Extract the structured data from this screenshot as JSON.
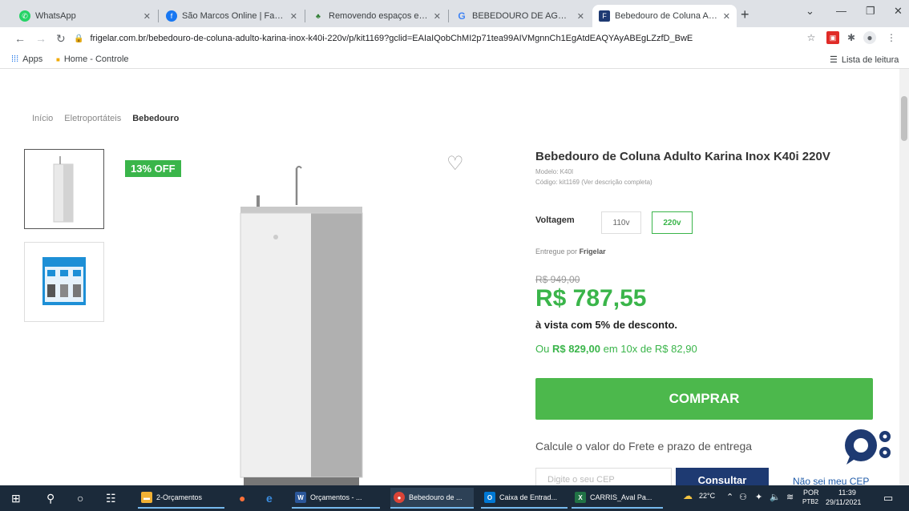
{
  "browser": {
    "tabs": [
      {
        "label": "WhatsApp",
        "icon": "whatsapp-icon",
        "color": "#25d366"
      },
      {
        "label": "São Marcos Online | Facebo",
        "icon": "facebook-icon",
        "color": "#1877f2"
      },
      {
        "label": "Removendo espaços em bra",
        "icon": "plant-icon",
        "color": "#2e7d32"
      },
      {
        "label": "BEBEDOURO DE AGUA MCA",
        "icon": "google-icon",
        "color": "#4285f4"
      },
      {
        "label": "Bebedouro de Coluna Adult",
        "icon": "frigelar-icon",
        "color": "#1e3a72"
      }
    ],
    "url": "frigelar.com.br/bebedouro-de-coluna-adulto-karina-inox-k40i-220v/p/kit1169?gclid=EAIaIQobChMI2p71tea99AIVMgnnCh1EgAtdEAQYAyABEgLZzfD_BwE",
    "bookmarks": {
      "apps_label": "Apps",
      "home_label": "Home - Controle",
      "reading_list_label": "Lista de leitura"
    }
  },
  "page": {
    "breadcrumb": [
      "Início",
      "Eletroportáteis",
      "Bebedouro"
    ],
    "badge": "13% OFF",
    "title": "Bebedouro de Coluna Adulto Karina Inox K40i 220V",
    "model": "Modelo: K40I",
    "code": "Código: kit1169 (Ver descrição completa)",
    "voltage_label": "Voltagem",
    "voltage_options": [
      "110v",
      "220v"
    ],
    "voltage_selected": "220v",
    "seller_prefix": "Entregue por",
    "seller_name": "Frigelar",
    "old_price": "R$ 949,00",
    "price": "R$ 787,55",
    "discount_text": "à vista com 5% de desconto.",
    "installment_prefix": "Ou",
    "installment_total": "R$ 829,00",
    "installment_suffix": "em 10x de R$ 82,90",
    "buy_label": "COMPRAR",
    "shipping_title": "Calcule o valor do Frete e prazo de entrega",
    "cep_placeholder": "Digite o seu CEP",
    "consult_label": "Consultar",
    "dont_know_cep": "Não sei meu CEP",
    "brand_color": "#3ab54a",
    "navy_color": "#1e3a72"
  },
  "taskbar": {
    "apps": [
      {
        "label": "2-Orçamentos",
        "icon": "folder-icon",
        "color": "#f2b134"
      },
      {
        "label": "Orçamentos - ...",
        "icon": "word-icon",
        "color": "#2b579a"
      },
      {
        "label": "Bebedouro de ...",
        "icon": "chrome-icon",
        "color": "#db4437"
      },
      {
        "label": "Caixa de Entrad...",
        "icon": "outlook-icon",
        "color": "#0078d4"
      },
      {
        "label": "CARRIS_Aval Pa...",
        "icon": "excel-icon",
        "color": "#217346"
      }
    ],
    "weather": "22°C",
    "lang": "POR",
    "lang2": "PTB2",
    "time": "11:39",
    "date": "29/11/2021"
  }
}
